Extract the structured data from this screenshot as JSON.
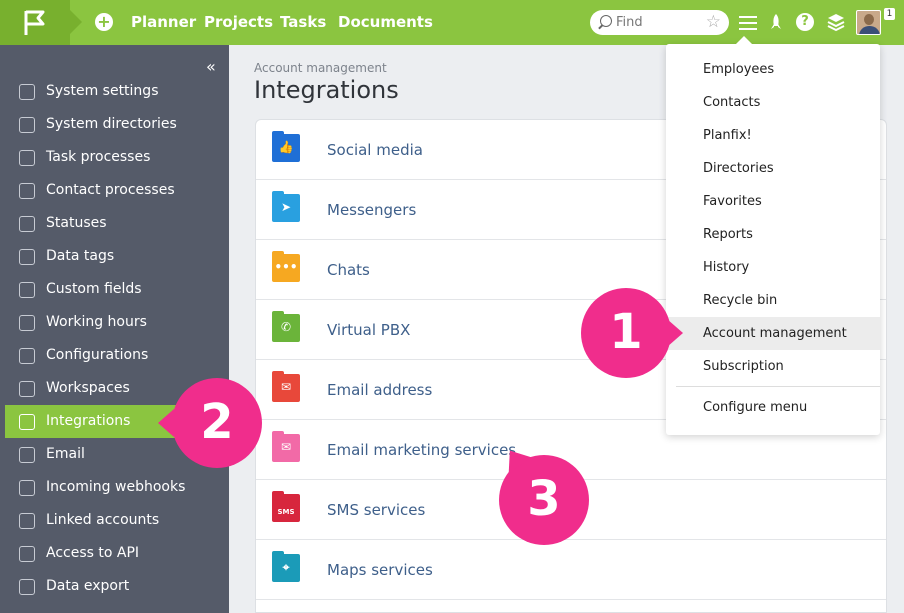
{
  "topbar": {
    "nav": [
      "Planner",
      "Projects",
      "Tasks",
      "Documents"
    ],
    "search_placeholder": "Find",
    "notifications_count": "1",
    "accent_color": "#8bc540"
  },
  "sidebar": {
    "collapse_icon": "«",
    "items": [
      {
        "label": "System settings",
        "icon": "sliders-icon"
      },
      {
        "label": "System directories",
        "icon": "list-icon"
      },
      {
        "label": "Task processes",
        "icon": "diamond-icon"
      },
      {
        "label": "Contact processes",
        "icon": "contact-card-icon"
      },
      {
        "label": "Statuses",
        "icon": "statuses-icon"
      },
      {
        "label": "Data tags",
        "icon": "tag-wave-icon"
      },
      {
        "label": "Custom fields",
        "icon": "fields-icon"
      },
      {
        "label": "Working hours",
        "icon": "clock-icon"
      },
      {
        "label": "Configurations",
        "icon": "configurations-icon"
      },
      {
        "label": "Workspaces",
        "icon": "workspaces-icon"
      },
      {
        "label": "Integrations",
        "icon": "flag-icon",
        "active": true
      },
      {
        "label": "Email",
        "icon": "envelope-icon"
      },
      {
        "label": "Incoming webhooks",
        "icon": "webhook-icon"
      },
      {
        "label": "Linked accounts",
        "icon": "link-icon"
      },
      {
        "label": "Access to API",
        "icon": "api-icon"
      },
      {
        "label": "Data export",
        "icon": "export-icon"
      }
    ]
  },
  "main": {
    "breadcrumb": "Account management",
    "title": "Integrations",
    "rows": [
      {
        "label": "Social media",
        "color": "#1f6fd6",
        "icon": "thumbs-up-icon",
        "glyph": "👍"
      },
      {
        "label": "Messengers",
        "color": "#29a0e0",
        "icon": "telegram-icon",
        "glyph": "➤"
      },
      {
        "label": "Chats",
        "color": "#f6a821",
        "icon": "chat-bubble-icon",
        "glyph": "•••"
      },
      {
        "label": "Virtual PBX",
        "color": "#6bb43a",
        "icon": "phone-icon",
        "glyph": "✆"
      },
      {
        "label": "Email address",
        "color": "#e8483a",
        "icon": "envelope-icon",
        "glyph": "✉"
      },
      {
        "label": "Email marketing services",
        "color": "#f26aa7",
        "icon": "email-marketing-icon",
        "glyph": "✉"
      },
      {
        "label": "SMS services",
        "color": "#d7263d",
        "icon": "sms-icon",
        "glyph": "SMS"
      },
      {
        "label": "Maps services",
        "color": "#1b9bb8",
        "icon": "map-pin-icon",
        "glyph": "⌖"
      }
    ]
  },
  "dropdown": {
    "items": [
      "Employees",
      "Contacts",
      "Planfix!",
      "Directories",
      "Favorites",
      "Reports",
      "History",
      "Recycle bin",
      "Account management",
      "Subscription"
    ],
    "hovered": "Account management",
    "footer_item": "Configure menu"
  },
  "callouts": [
    "1",
    "2",
    "3"
  ],
  "callout_color": "#f02d8c"
}
